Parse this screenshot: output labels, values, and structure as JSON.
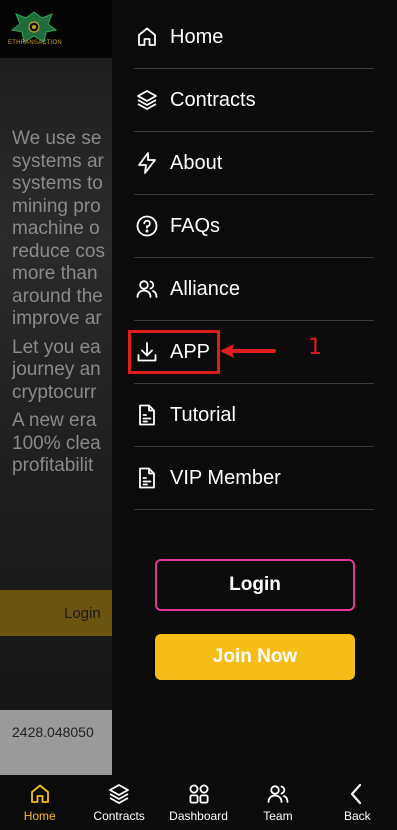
{
  "background": {
    "logo_text": "ETHRANSACTION",
    "paragraphs": [
      [
        "We use se",
        "systems ar",
        "systems to",
        "mining pro",
        "machine o",
        "reduce cos",
        "more than",
        "around the",
        "improve ar"
      ],
      [
        "Let you ea",
        "journey an",
        "cryptocurr"
      ],
      [
        "A new era",
        "100% clea",
        "profitabilit"
      ]
    ],
    "login_label": "Login",
    "value": "2428.048050"
  },
  "drawer": {
    "items": [
      {
        "label": "Home",
        "icon": "home-icon"
      },
      {
        "label": "Contracts",
        "icon": "layers-icon"
      },
      {
        "label": "About",
        "icon": "lightning-icon"
      },
      {
        "label": "FAQs",
        "icon": "question-icon"
      },
      {
        "label": "Alliance",
        "icon": "users-icon"
      },
      {
        "label": "APP",
        "icon": "download-icon"
      },
      {
        "label": "Tutorial",
        "icon": "document-icon"
      },
      {
        "label": "VIP Member",
        "icon": "document-icon"
      }
    ],
    "annotation_number": "1",
    "login_label": "Login",
    "join_label": "Join Now"
  },
  "bottom_nav": {
    "items": [
      {
        "label": "Home",
        "icon": "home-icon",
        "active": true
      },
      {
        "label": "Contracts",
        "icon": "layers-icon"
      },
      {
        "label": "Dashboard",
        "icon": "grid-icon"
      },
      {
        "label": "Team",
        "icon": "users-icon"
      },
      {
        "label": "Back",
        "icon": "chevron-left-icon"
      }
    ]
  },
  "colors": {
    "accent": "#f6bd16",
    "login_border": "#e0379b",
    "annotation": "#e11c1c"
  }
}
